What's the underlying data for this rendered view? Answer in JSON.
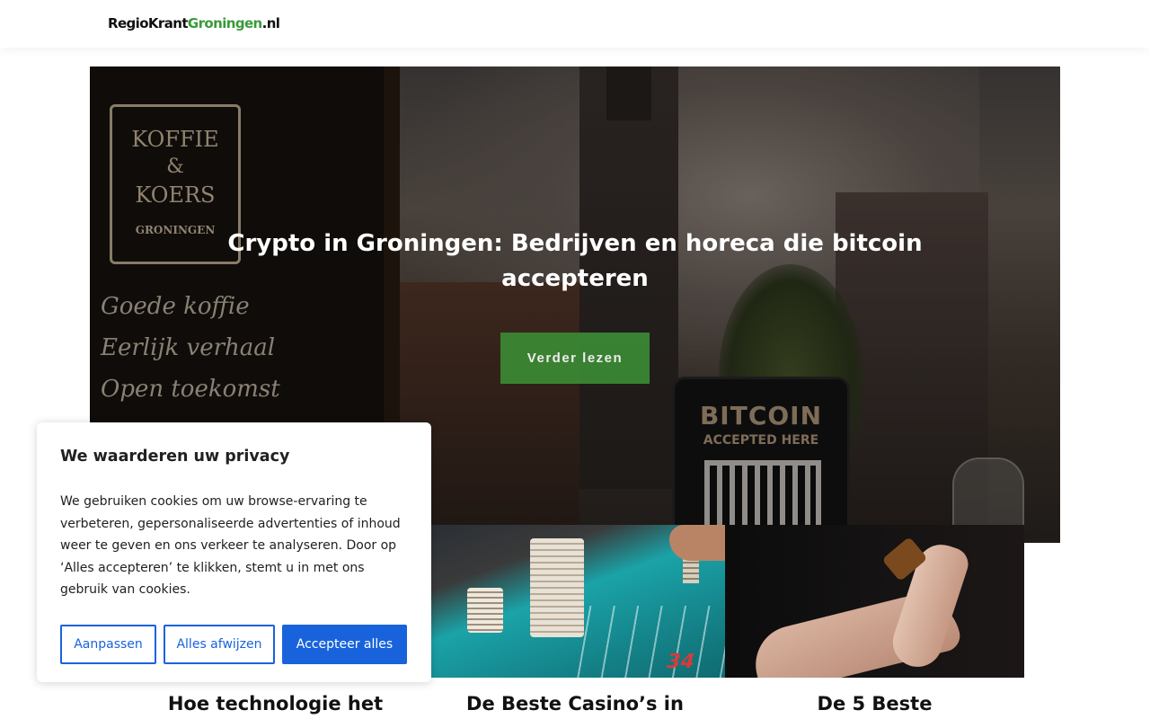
{
  "header": {
    "logo": {
      "part1": "RegioKrant",
      "part2": "Groningen",
      "part3": ".nl"
    }
  },
  "hero": {
    "title": "Crypto in Groningen: Bedrijven en horeca die bitcoin accepteren",
    "button_label": "Verder lezen",
    "image_text": {
      "board_line1": "KOFFIE",
      "board_line2": "&",
      "board_line3": "KOERS",
      "board_line4": "GRONINGEN",
      "chalk1": "Goede koffie",
      "chalk2": "Eerlijk verhaal",
      "chalk3": "Open toekomst",
      "sign_line1": "BITCOIN",
      "sign_line2": "ACCEPTED HERE"
    }
  },
  "articles": [
    {
      "title": "Hoe technologie het"
    },
    {
      "title": "De Beste Casino’s in"
    },
    {
      "title": "De 5 Beste"
    }
  ],
  "casino_image_number": "34",
  "cookie_banner": {
    "title": "We waarderen uw privacy",
    "body": "We gebruiken cookies om uw browse-ervaring te verbeteren, gepersonaliseerde advertenties of inhoud weer te geven en ons verkeer te analyseren. Door op ‘Alles accepteren’ te klikken, stemt u in met ons gebruik van cookies.",
    "btn_customize": "Aanpassen",
    "btn_reject": "Alles afwijzen",
    "btn_accept": "Accepteer alles"
  },
  "colors": {
    "brand_green": "#3a9a3a",
    "button_green": "#3c8a35",
    "cookie_blue": "#1863dc"
  }
}
